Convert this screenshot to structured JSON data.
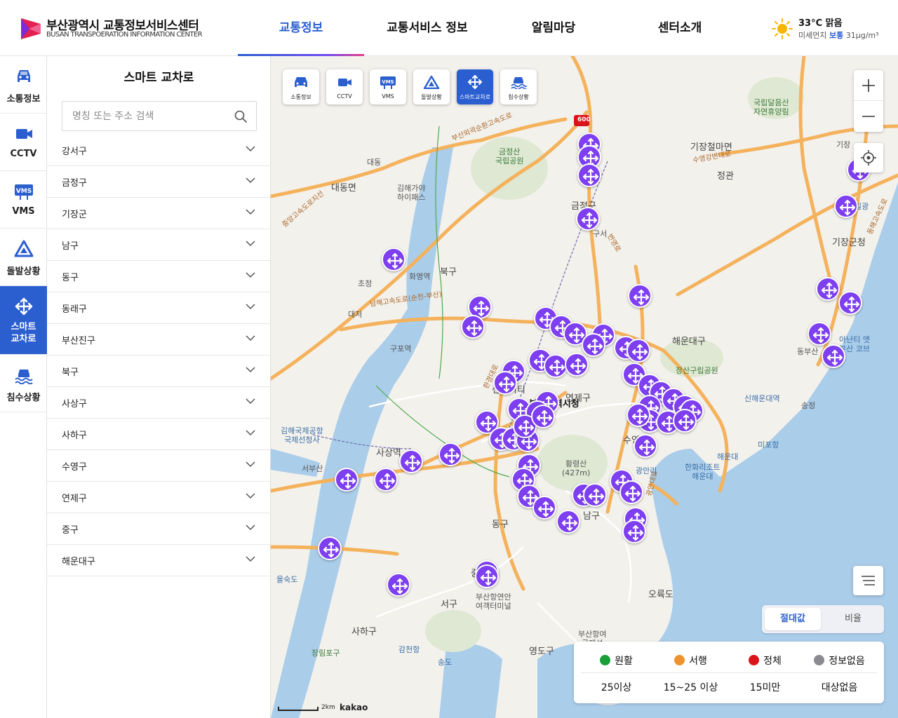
{
  "header": {
    "logo_title": "부산광역시 교통정보서비스센터",
    "logo_subtitle": "BUSAN TRANSPOERATION INFORMATION CENTER",
    "nav": [
      "교통정보",
      "교통서비스 정보",
      "알림마당",
      "센터소개"
    ],
    "active_nav": "교통정보",
    "weather": {
      "temp": "33°C 맑음",
      "dust_label": "미세먼지",
      "dust_status": "보통",
      "dust_value": "31μg/m³",
      "icon": "sun-icon"
    }
  },
  "rail": [
    {
      "label": "소통정보",
      "icon": "car-icon"
    },
    {
      "label": "CCTV",
      "icon": "camera-icon"
    },
    {
      "label": "VMS",
      "icon": "vms-icon"
    },
    {
      "label": "돌발상황",
      "icon": "warning-icon"
    },
    {
      "label": "스마트\n교차로",
      "icon": "move-arrows-icon",
      "active": true
    },
    {
      "label": "침수상황",
      "icon": "flood-icon"
    }
  ],
  "panel": {
    "title": "스마트 교차로",
    "search_placeholder": "명칭 또는 주소 검색",
    "districts": [
      "강서구",
      "금정구",
      "기장군",
      "남구",
      "동구",
      "동래구",
      "부산진구",
      "북구",
      "사상구",
      "사하구",
      "수영구",
      "연제구",
      "중구",
      "해운대구"
    ]
  },
  "map": {
    "layers": [
      {
        "label": "소통정보",
        "icon": "car-icon"
      },
      {
        "label": "CCTV",
        "icon": "camera-icon"
      },
      {
        "label": "VMS",
        "icon": "vms-icon"
      },
      {
        "label": "돌발상황",
        "icon": "warning-icon"
      },
      {
        "label": "스마트교차로",
        "icon": "move-arrows-icon",
        "active": true
      },
      {
        "label": "침수상황",
        "icon": "flood-icon"
      }
    ],
    "labels": [
      "대동면",
      "대동",
      "김해가야\n하이패스",
      "금정산\n국립공원",
      "금정구",
      "구서",
      "북구",
      "화명역",
      "초정",
      "대저",
      "구포역",
      "해운대구",
      "장산구립공원",
      "신해운대역",
      "송정",
      "기장군청",
      "기장",
      "일광",
      "동부산",
      "아난티 앳\n부산 코브",
      "연제구",
      "부산광역시청",
      "수영",
      "광안리",
      "미포항",
      "해운대",
      "한화리조트\n해운대",
      "황령산\n(427m)",
      "남구",
      "동구",
      "오륙도",
      "중구",
      "서구",
      "부산항연안\n여객터미널",
      "사하구",
      "영도구",
      "부산항여\n국제선",
      "감천항",
      "장림포구",
      "송도",
      "을숙도",
      "사상역",
      "서부산",
      "김해국제공항\n국제선청사",
      "국립달음산\n자연휴양림",
      "기장철마면",
      "정관",
      "센텀시티"
    ],
    "scale_text": "2km",
    "provider": "kakao",
    "toggle": {
      "on": "절대값",
      "off": "비율"
    },
    "legend": [
      {
        "label": "원활",
        "color": "#1a9e3a",
        "range": "25이상"
      },
      {
        "label": "서행",
        "color": "#f0922a",
        "range": "15~25 이상"
      },
      {
        "label": "정체",
        "color": "#d9141b",
        "range": "15미만"
      },
      {
        "label": "정보없음",
        "color": "#8a8a90",
        "range": "대상없음"
      }
    ],
    "road_labels": [
      "남해고속도로(순천-부산)",
      "부산외곽순환고속도로",
      "중앙고속도로지선",
      "번영로",
      "광안대로",
      "동해고속도로",
      "수영강변대로",
      "환경대로"
    ],
    "route_badge": "600"
  }
}
